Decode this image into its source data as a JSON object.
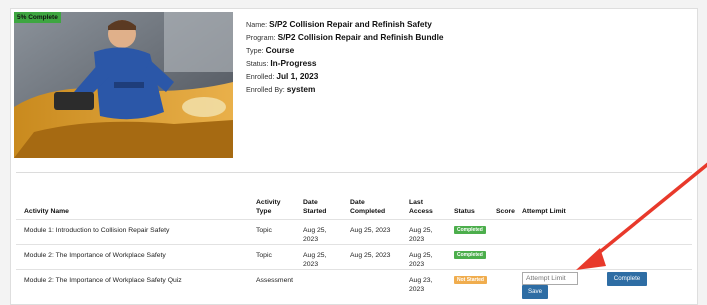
{
  "progress": {
    "label": "5% Complete",
    "value": 0.05
  },
  "course": {
    "name_label": "Name:",
    "name": "S/P2 Collision Repair and Refinish Safety",
    "program_label": "Program:",
    "program": "S/P2 Collision Repair and Refinish Bundle",
    "type_label": "Type:",
    "type": "Course",
    "status_label": "Status:",
    "status": "In-Progress",
    "enrolled_label": "Enrolled:",
    "enrolled": "Jul 1, 2023",
    "enrolled_by_label": "Enrolled By:",
    "enrolled_by": "system"
  },
  "table": {
    "headers": {
      "activity_name": "Activity Name",
      "activity_type": "Activity Type",
      "date_started": "Date Started",
      "date_completed": "Date Completed",
      "last_access": "Last Access",
      "status": "Status",
      "score": "Score",
      "attempt_limit": "Attempt Limit"
    },
    "rows": [
      {
        "name": "Module 1: Introduction to Collision Repair Safety",
        "type": "Topic",
        "started": "Aug 25, 2023",
        "completed": "Aug 25, 2023",
        "last_access": "Aug 25, 2023",
        "status": "Completed",
        "status_color": "#4cae4c"
      },
      {
        "name": "Module 2: The Importance of Workplace Safety",
        "type": "Topic",
        "started": "Aug 25, 2023",
        "completed": "Aug 25, 2023",
        "last_access": "Aug 25, 2023",
        "status": "Completed",
        "status_color": "#4cae4c"
      },
      {
        "name": "Module 2: The Importance of Workplace Safety Quiz",
        "type": "Assessment",
        "started": "",
        "completed": "",
        "last_access": "Aug 23, 2023",
        "status": "Not Started",
        "status_color": "#f0ad4e"
      }
    ]
  },
  "attempt_input": {
    "placeholder": "Attempt Limit"
  },
  "buttons": {
    "complete": "Complete",
    "save": "Save"
  },
  "colors": {
    "primary": "#2e6da4",
    "success": "#4cae4c",
    "warning": "#f0ad4e",
    "annotation_arrow": "#e8392b"
  }
}
